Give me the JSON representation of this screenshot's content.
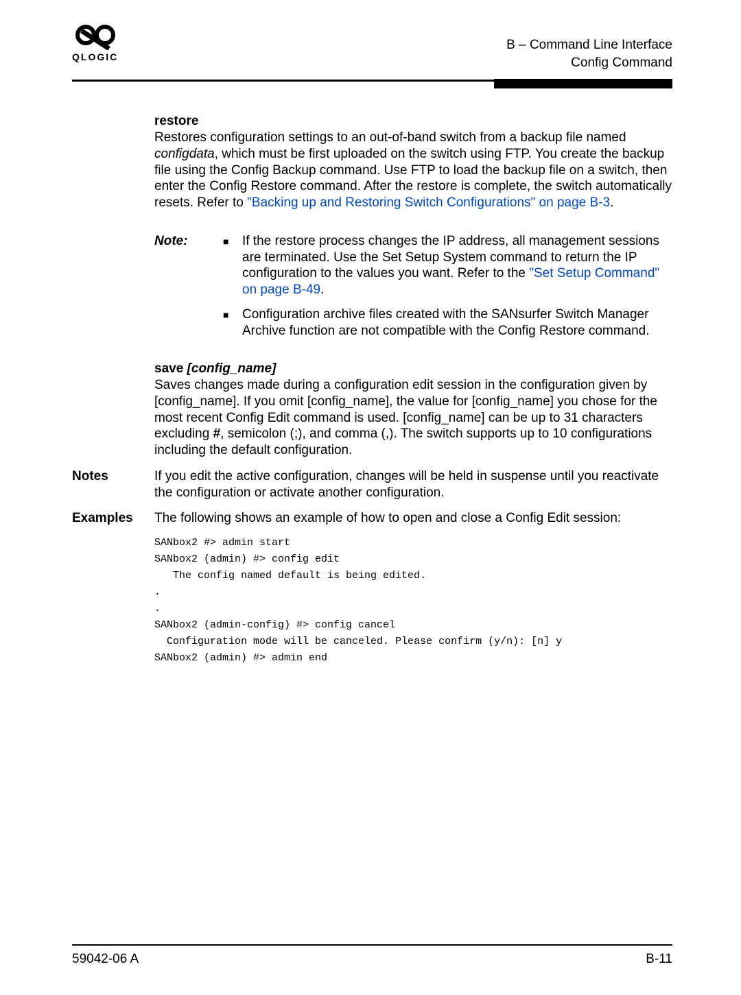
{
  "header": {
    "line1": "B – Command Line Interface",
    "line2": "Config Command"
  },
  "logo_word": "QLOGIC",
  "restore": {
    "heading": "restore",
    "p1a": "Restores configuration settings to an out-of-band switch from a backup file named ",
    "p1b_italic": "configdata",
    "p1c": ", which must be first uploaded on the switch using FTP. You create the backup file using the Config Backup command. Use FTP to load the backup file on a switch, then enter the Config Restore command. After the restore is complete, the switch automatically resets. Refer to ",
    "link1": "\"Backing up and Restoring Switch Configurations\" on page B-3",
    "p1d": "."
  },
  "note": {
    "label": "Note:",
    "b1a": "If the restore process changes the IP address, all management sessions are terminated. Use the Set Setup System command to return the IP configuration to the values you want. Refer to the ",
    "b1_link": "\"Set Setup Command\" on page B-49",
    "b1b": ".",
    "b2": "Configuration archive files created with the SANsurfer Switch Manager Archive function are not compatible with the Config Restore command."
  },
  "save": {
    "heading_b": "save ",
    "heading_i": "[config_name]",
    "p": "Saves changes made during a configuration edit session in the configuration given by [config_name]. If you omit [config_name], the value for [config_name] you chose for the most recent Config Edit command is used. [config_name] can be up to 31 characters excluding ",
    "p_hash": "#",
    "p_tail": ", semicolon (;), and comma (,). The switch supports up to 10 configurations including the default configuration."
  },
  "notes": {
    "label": "Notes",
    "p": "If you edit the active configuration, changes will be held in suspense until you reactivate the configuration or activate another configuration."
  },
  "examples": {
    "label": "Examples",
    "p": "The following shows an example of how to open and close a Config Edit session:",
    "code": "SANbox2 #> admin start\nSANbox2 (admin) #> config edit\n   The config named default is being edited.\n.\n.\nSANbox2 (admin-config) #> config cancel\n  Configuration mode will be canceled. Please confirm (y/n): [n] y\nSANbox2 (admin) #> admin end"
  },
  "footer": {
    "left": "59042-06  A",
    "right": "B-11"
  }
}
